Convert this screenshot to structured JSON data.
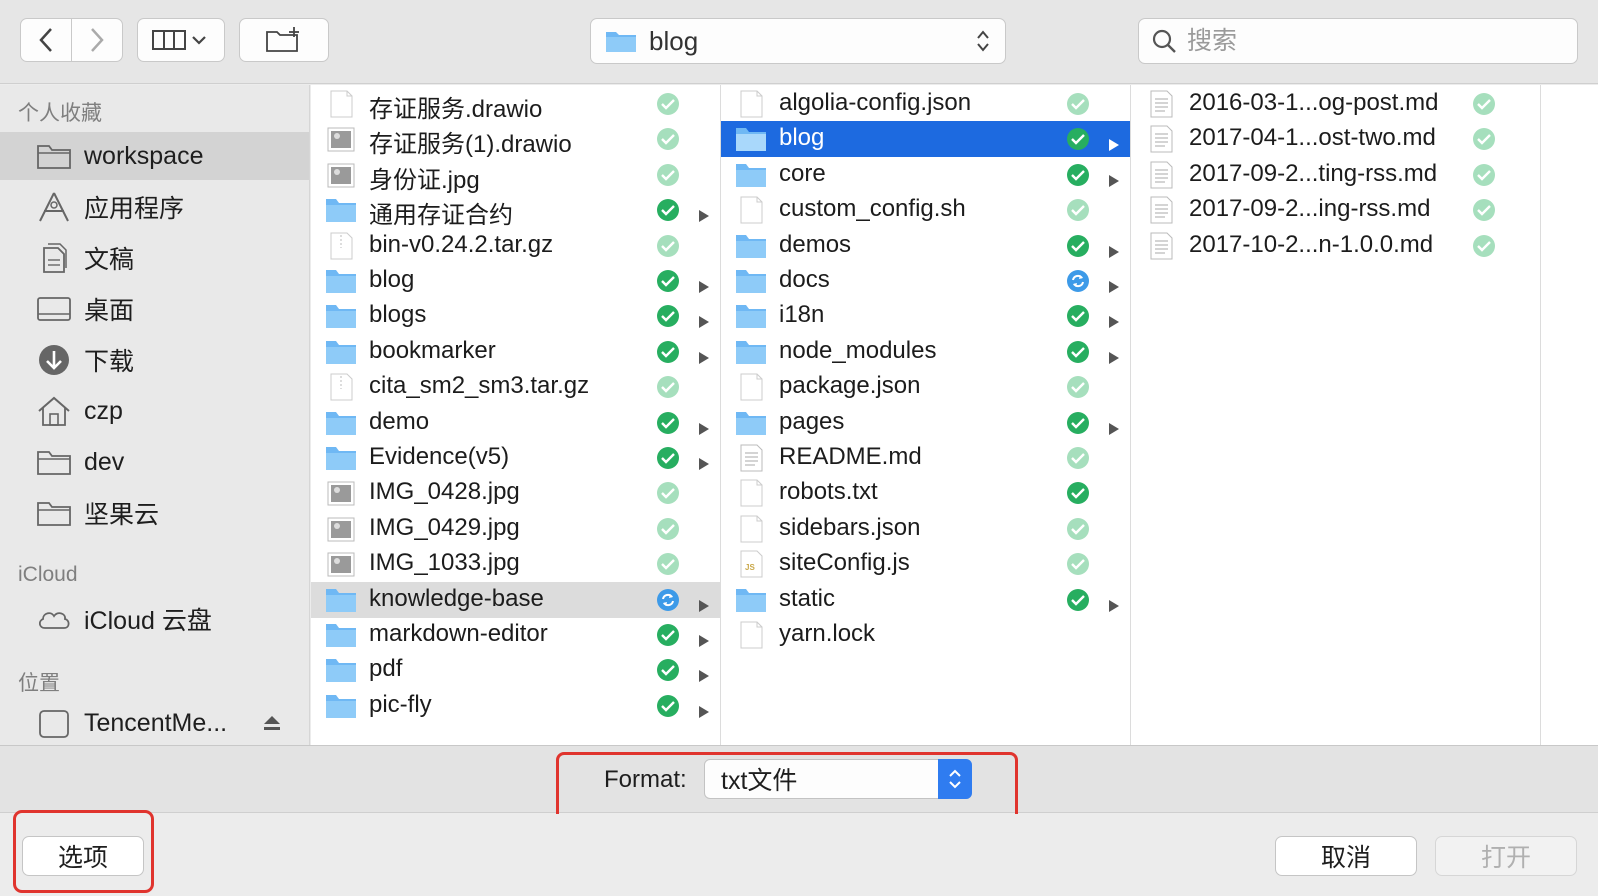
{
  "toolbar": {
    "path_label": "blog",
    "search_placeholder": "搜索"
  },
  "sidebar": {
    "favorites_header": "个人收藏",
    "favorites": [
      {
        "label": "workspace",
        "icon": "folder-icon",
        "selected": true
      },
      {
        "label": "应用程序",
        "icon": "applications-icon"
      },
      {
        "label": "文稿",
        "icon": "documents-icon"
      },
      {
        "label": "桌面",
        "icon": "desktop-icon"
      },
      {
        "label": "下载",
        "icon": "downloads-icon"
      },
      {
        "label": "czp",
        "icon": "home-icon"
      },
      {
        "label": "dev",
        "icon": "folder-icon"
      },
      {
        "label": "坚果云",
        "icon": "folder-icon"
      }
    ],
    "icloud_header": "iCloud",
    "icloud": [
      {
        "label": "iCloud 云盘",
        "icon": "cloud-icon"
      }
    ],
    "locations_header": "位置",
    "locations": [
      {
        "label": "TencentMe...",
        "icon": "disk-icon"
      }
    ]
  },
  "columns": {
    "col1": [
      {
        "name": "存证服务.drawio",
        "kind": "file",
        "dim": true,
        "status": "synced"
      },
      {
        "name": "存证服务(1).drawio",
        "kind": "image",
        "dim": true,
        "status": "synced"
      },
      {
        "name": "身份证.jpg",
        "kind": "image",
        "dim": true,
        "status": "synced"
      },
      {
        "name": "通用存证合约",
        "kind": "folder",
        "status": "synced"
      },
      {
        "name": "bin-v0.24.2.tar.gz",
        "kind": "archive",
        "dim": true,
        "status": "synced"
      },
      {
        "name": "blog",
        "kind": "folder",
        "status": "synced"
      },
      {
        "name": "blogs",
        "kind": "folder",
        "status": "synced"
      },
      {
        "name": "bookmarker",
        "kind": "folder",
        "status": "synced"
      },
      {
        "name": "cita_sm2_sm3.tar.gz",
        "kind": "archive",
        "dim": true,
        "status": "synced"
      },
      {
        "name": "demo",
        "kind": "folder",
        "status": "synced"
      },
      {
        "name": "Evidence(v5)",
        "kind": "folder",
        "status": "synced"
      },
      {
        "name": "IMG_0428.jpg",
        "kind": "image",
        "dim": true,
        "status": "synced"
      },
      {
        "name": "IMG_0429.jpg",
        "kind": "image",
        "dim": true,
        "status": "synced"
      },
      {
        "name": "IMG_1033.jpg",
        "kind": "image",
        "dim": true,
        "status": "synced"
      },
      {
        "name": "knowledge-base",
        "kind": "folder",
        "status": "syncing",
        "selected": "gray"
      },
      {
        "name": "markdown-editor",
        "kind": "folder",
        "status": "synced"
      },
      {
        "name": "pdf",
        "kind": "folder",
        "status": "synced"
      },
      {
        "name": "pic-fly",
        "kind": "folder",
        "status": "synced"
      }
    ],
    "col2": [
      {
        "name": "algolia-config.json",
        "kind": "file",
        "dim": true,
        "status": "synced"
      },
      {
        "name": "blog",
        "kind": "folder",
        "status": "synced",
        "selected": "blue"
      },
      {
        "name": "core",
        "kind": "folder",
        "status": "synced"
      },
      {
        "name": "custom_config.sh",
        "kind": "file",
        "dim": true,
        "status": "synced"
      },
      {
        "name": "demos",
        "kind": "folder",
        "status": "synced"
      },
      {
        "name": "docs",
        "kind": "folder",
        "status": "syncing"
      },
      {
        "name": "i18n",
        "kind": "folder",
        "status": "synced"
      },
      {
        "name": "node_modules",
        "kind": "folder",
        "status": "synced"
      },
      {
        "name": "package.json",
        "kind": "file",
        "dim": true,
        "status": "synced"
      },
      {
        "name": "pages",
        "kind": "folder",
        "status": "synced"
      },
      {
        "name": "README.md",
        "kind": "text",
        "dim": true,
        "status": "synced"
      },
      {
        "name": "robots.txt",
        "kind": "file",
        "status": "synced"
      },
      {
        "name": "sidebars.json",
        "kind": "file",
        "dim": true,
        "status": "synced"
      },
      {
        "name": "siteConfig.js",
        "kind": "js",
        "dim": true,
        "status": "synced"
      },
      {
        "name": "static",
        "kind": "folder",
        "status": "synced"
      },
      {
        "name": "yarn.lock",
        "kind": "file",
        "dim": true,
        "status": "none"
      }
    ],
    "col3": [
      {
        "name": "2016-03-1...og-post.md",
        "kind": "text",
        "dim": true,
        "status": "synced"
      },
      {
        "name": "2017-04-1...ost-two.md",
        "kind": "text",
        "dim": true,
        "status": "synced"
      },
      {
        "name": "2017-09-2...ting-rss.md",
        "kind": "text",
        "dim": true,
        "status": "synced"
      },
      {
        "name": "2017-09-2...ing-rss.md",
        "kind": "text",
        "dim": true,
        "status": "synced"
      },
      {
        "name": "2017-10-2...n-1.0.0.md",
        "kind": "text",
        "dim": true,
        "status": "synced"
      }
    ]
  },
  "format": {
    "label": "Format:",
    "value": "txt文件"
  },
  "actions": {
    "options_label": "选项",
    "cancel_label": "取消",
    "open_label": "打开"
  },
  "colors": {
    "selection_blue": "#1d6ae0",
    "sync_green": "#27ae60",
    "sync_blue": "#3d9ae8",
    "highlight_red": "#e0342e",
    "folder_blue": "#6fb8f4"
  }
}
